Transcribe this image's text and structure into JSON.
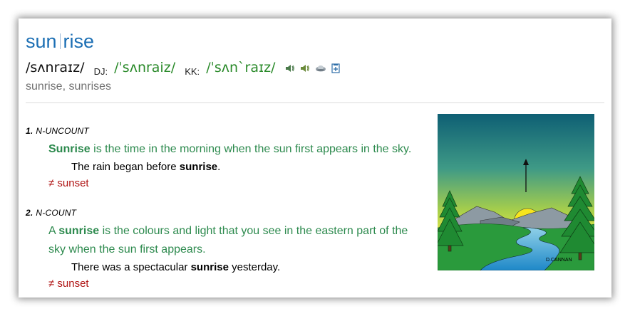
{
  "entry": {
    "headword_part1": "sun",
    "headword_part2": "rise",
    "pron_plain": "/sʌnraɪz/",
    "dj_label": "DJ:",
    "dj_pron": "/ˈsʌnraiz/",
    "kk_label": "KK:",
    "kk_pron": "/ˈsʌnˋraɪz/",
    "inflections": "sunrise, sunrises",
    "icons": [
      "speaker-uk-icon",
      "speaker-us-icon",
      "cloud-icon",
      "bookmark-add-icon"
    ]
  },
  "senses": [
    {
      "number": "1.",
      "grammar": "N-UNCOUNT",
      "def_before": "",
      "def_headword": "Sunrise",
      "def_after": " is the time in the morning when the sun first appears in the sky.",
      "example_before": "The rain began before ",
      "example_bold": "sunrise",
      "example_after": ".",
      "antonym": "≠ sunset"
    },
    {
      "number": "2.",
      "grammar": "N-COUNT",
      "def_before": "A ",
      "def_headword": "sunrise",
      "def_after": " is the colours and light that you see in the eastern part of the sky when the sun first appears.",
      "example_before": "There was a spectacular ",
      "example_bold": "sunrise",
      "example_after": " yesterday.",
      "antonym": "≠ sunset"
    }
  ],
  "illustration": {
    "credit": "D.CANNAN"
  },
  "colors": {
    "headword": "#1c6fb4",
    "pron_green": "#2a8a2a",
    "definition": "#2d8a4e",
    "antonym": "#b01515"
  }
}
